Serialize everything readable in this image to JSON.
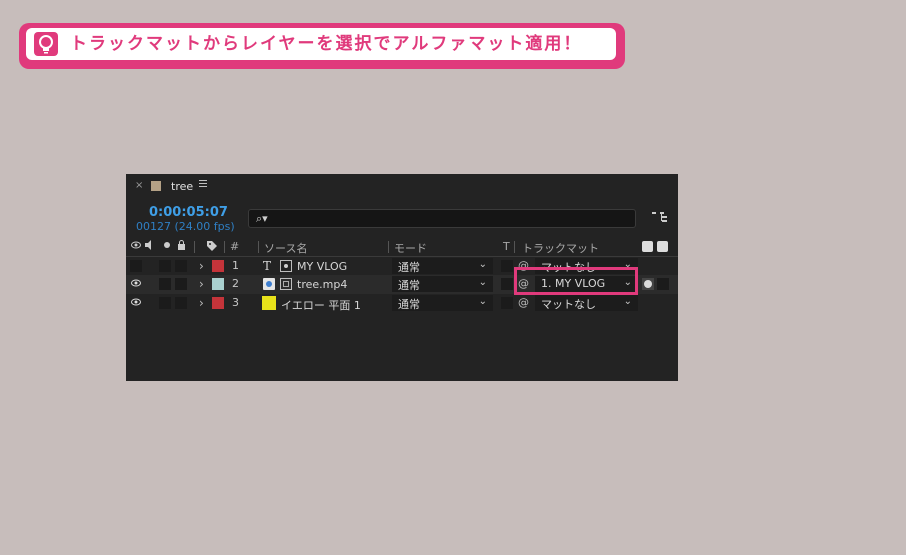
{
  "tip": {
    "text": "トラックマットからレイヤーを選択でアルファマット適用！",
    "icon": "lightbulb-icon",
    "accent": "#e03a7c"
  },
  "panel": {
    "tab_close": "×",
    "tab_name": "tree",
    "timecode": "0:00:05:07",
    "frames": "00127 (24.00 fps)",
    "search_glyph": "⌕▾",
    "columns": {
      "number": "#",
      "source_name": "ソース名",
      "mode": "モード",
      "t": "T",
      "track_matte": "トラックマット"
    },
    "layers": [
      {
        "num": "1",
        "type_glyph": "T",
        "name": "MY VLOG",
        "mode": "通常",
        "matte": "マットなし",
        "label_color": "#c4343a",
        "visible": false
      },
      {
        "num": "2",
        "type_glyph": "",
        "name": "tree.mp4",
        "mode": "通常",
        "matte": "1. MY VLOG",
        "label_color": "#a9d0cf",
        "visible": true
      },
      {
        "num": "3",
        "type_glyph": "",
        "name": "イエロー 平面 1",
        "mode": "通常",
        "matte": "マットなし",
        "label_color": "#c4343a",
        "visible": true
      }
    ]
  }
}
